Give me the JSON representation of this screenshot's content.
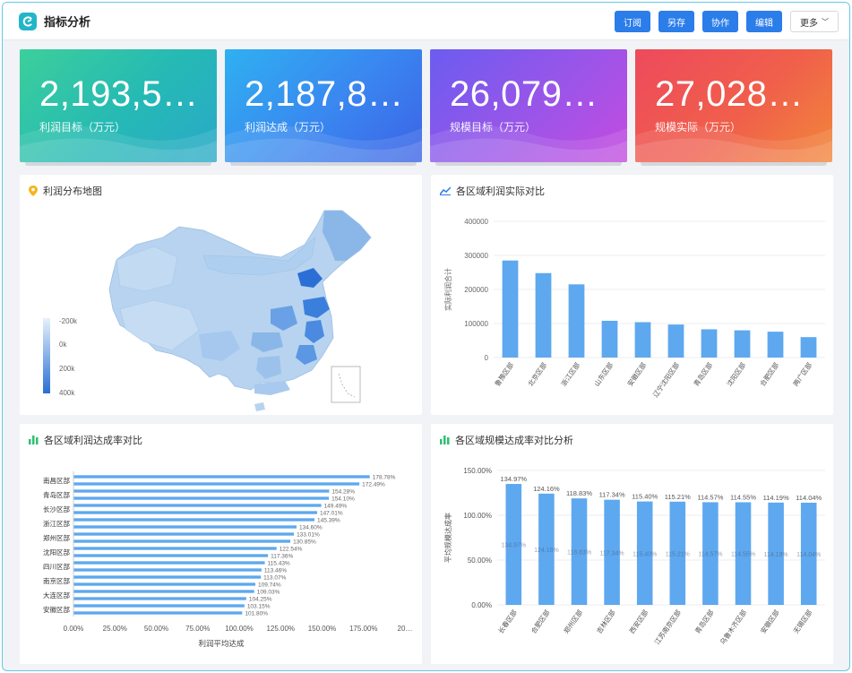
{
  "header": {
    "title": "指标分析",
    "buttons": [
      "订阅",
      "另存",
      "协作",
      "编辑"
    ],
    "more_label": "更多"
  },
  "kpis": [
    {
      "value": "2,193,5…",
      "label": "利润目标（万元）"
    },
    {
      "value": "2,187,8…",
      "label": "利润达成（万元）"
    },
    {
      "value": "26,079…",
      "label": "规模目标（万元）"
    },
    {
      "value": "27,028…",
      "label": "规模实际（万元）"
    }
  ],
  "map_panel": {
    "title": "利润分布地图",
    "legend": [
      "-200k",
      "0k",
      "200k",
      "400k"
    ]
  },
  "colors": {
    "primary": "#2b7de9",
    "bar": "#5ea8ef",
    "map_light": "#b6d3ef",
    "map_dark": "#2b6fd6"
  },
  "chart_data": [
    {
      "type": "bar",
      "title": "各区域利润实际对比",
      "ylabel": "实际利润合计",
      "categories": [
        "鲁豫区部",
        "北京区部",
        "浙江区部",
        "山东区部",
        "安徽区部",
        "辽宁沈阳区部",
        "青岛区部",
        "沈阳区部",
        "合肥区部",
        "两广区部"
      ],
      "values": [
        285000,
        248000,
        215000,
        108000,
        104000,
        97000,
        83000,
        80000,
        76000,
        60000
      ],
      "ylim": [
        0,
        400000
      ],
      "yticks": [
        "0",
        "100000",
        "200000",
        "300000",
        "400000"
      ]
    },
    {
      "type": "bar",
      "orientation": "horizontal",
      "title": "各区域利润达成率对比",
      "xlabel": "利润平均达成",
      "category_labels": [
        "南昌区部",
        "青岛区部",
        "长沙区部",
        "浙江区部",
        "郑州区部",
        "沈阳区部",
        "四川区部",
        "南京区部",
        "大连区部",
        "安徽区部"
      ],
      "value_labels": [
        "178.78%",
        "172.49%",
        "154.28%",
        "154.10%",
        "149.49%",
        "147.01%",
        "145.39%",
        "134.60%",
        "133.01%",
        "130.85%",
        "122.54%",
        "117.36%",
        "115.43%",
        "113.46%",
        "113.07%",
        "109.74%",
        "109.03%",
        "104.25%",
        "103.15%",
        "101.80%"
      ],
      "values": [
        178.78,
        172.49,
        154.28,
        154.1,
        149.49,
        147.01,
        145.39,
        134.6,
        133.01,
        130.85,
        122.54,
        117.36,
        115.43,
        113.46,
        113.07,
        109.74,
        109.03,
        104.25,
        103.15,
        101.8
      ],
      "xticks": [
        "0.00%",
        "25.00%",
        "50.00%",
        "75.00%",
        "100.00%",
        "125.00%",
        "150.00%",
        "175.00%",
        "20…"
      ],
      "xlim": [
        0,
        200
      ]
    },
    {
      "type": "bar",
      "title": "各区域规模达成率对比分析",
      "ylabel": "平均规模达成率",
      "categories": [
        "长春区部",
        "合肥区部",
        "郑州区部",
        "吉林区部",
        "西安区部",
        "江苏南京区部",
        "青岛区部",
        "乌鲁木齐区部",
        "安徽区部",
        "无锡区部"
      ],
      "values": [
        134.97,
        124.16,
        118.83,
        117.34,
        115.4,
        115.21,
        114.57,
        114.55,
        114.19,
        114.04
      ],
      "top_labels": [
        "134.97%",
        "124.16%",
        "118.83%",
        "117.34%",
        "115.40%",
        "115.21%",
        "114.57%",
        "114.55%",
        "114.19%",
        "114.04%"
      ],
      "inner_labels": [
        "134.97%",
        "124.16%",
        "118.83%",
        "117.34%",
        "115.40%",
        "115.21%",
        "114.57%",
        "114.55%",
        "114.19%",
        "114.04%"
      ],
      "ylim": [
        0,
        150
      ],
      "yticks": [
        "0.00%",
        "50.00%",
        "100.00%",
        "150.00%"
      ]
    }
  ]
}
